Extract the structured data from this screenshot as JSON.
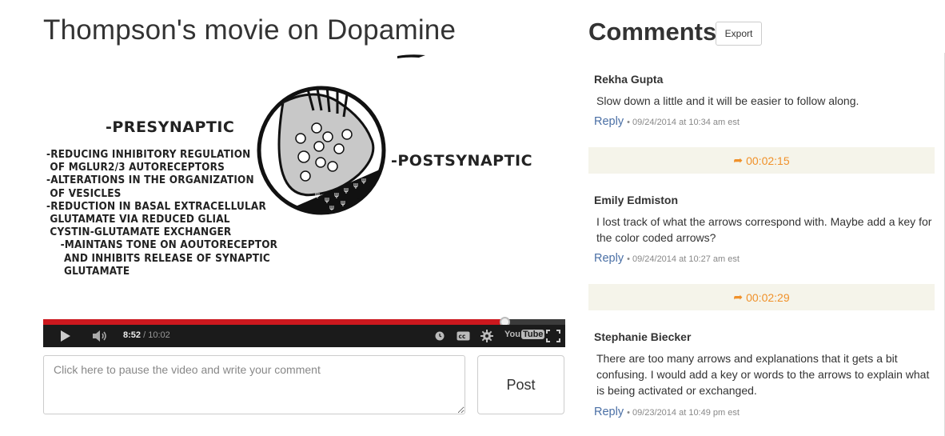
{
  "page": {
    "title": "Thompson's movie on Dopamine"
  },
  "slide": {
    "presynaptic_label": "-PRESYNAPTIC",
    "postsynaptic_label": "-POSTSYNAPTIC",
    "bullets": "-REDUCING INHIBITORY REGULATION\n OF MGLUR2/3 AUTORECEPTORS\n-ALTERATIONS IN THE ORGANIZATION\n OF VESICLES\n-REDUCTION IN BASAL EXTRACELLULAR\n GLUTAMATE VIA REDUCED GLIAL\n CYSTIN-GLUTAMATE EXCHANGER\n    -MAINTANS TONE ON AOUTORECEPTOR\n     AND INHIBITS RELEASE OF SYNAPTIC\n     GLUTAMATE"
  },
  "player": {
    "current_time": "8:52",
    "separator": " / ",
    "duration": "10:02",
    "progress_fraction": 0.8837,
    "youtube_you": "You",
    "youtube_tube": "Tube",
    "colors": {
      "progress": "#cc181e",
      "controls_bg": "#1b1b1b"
    }
  },
  "composer": {
    "placeholder": "Click here to pause the video and write your comment",
    "post_label": "Post"
  },
  "comments_header": {
    "title": "Comments",
    "export_label": "Export"
  },
  "comments": [
    {
      "author": "Rekha Gupta",
      "body": "Slow down a little and it will be easier to follow along.",
      "reply_label": "Reply",
      "meta": "• 09/24/2014 at 10:34 am est"
    },
    {
      "author": "Emily Edmiston",
      "body": "I lost track of what the arrows correspond with. Maybe add a key for the color coded arrows?",
      "reply_label": "Reply",
      "meta": "• 09/24/2014 at 10:27 am est"
    },
    {
      "author": "Stephanie Biecker",
      "body": "There are too many arrows and explanations that it gets a bit confusing. I would add a key or words to the arrows to explain what is being activated or exchanged.",
      "reply_label": "Reply",
      "meta": "• 09/23/2014 at 10:49 pm est"
    }
  ],
  "timestamps": [
    {
      "time": "00:02:15"
    },
    {
      "time": "00:02:29"
    }
  ],
  "accent": {
    "timestamp_color": "#f0912a",
    "timestamp_bg": "#f5f4ea",
    "link_color": "#4a6fa5"
  }
}
